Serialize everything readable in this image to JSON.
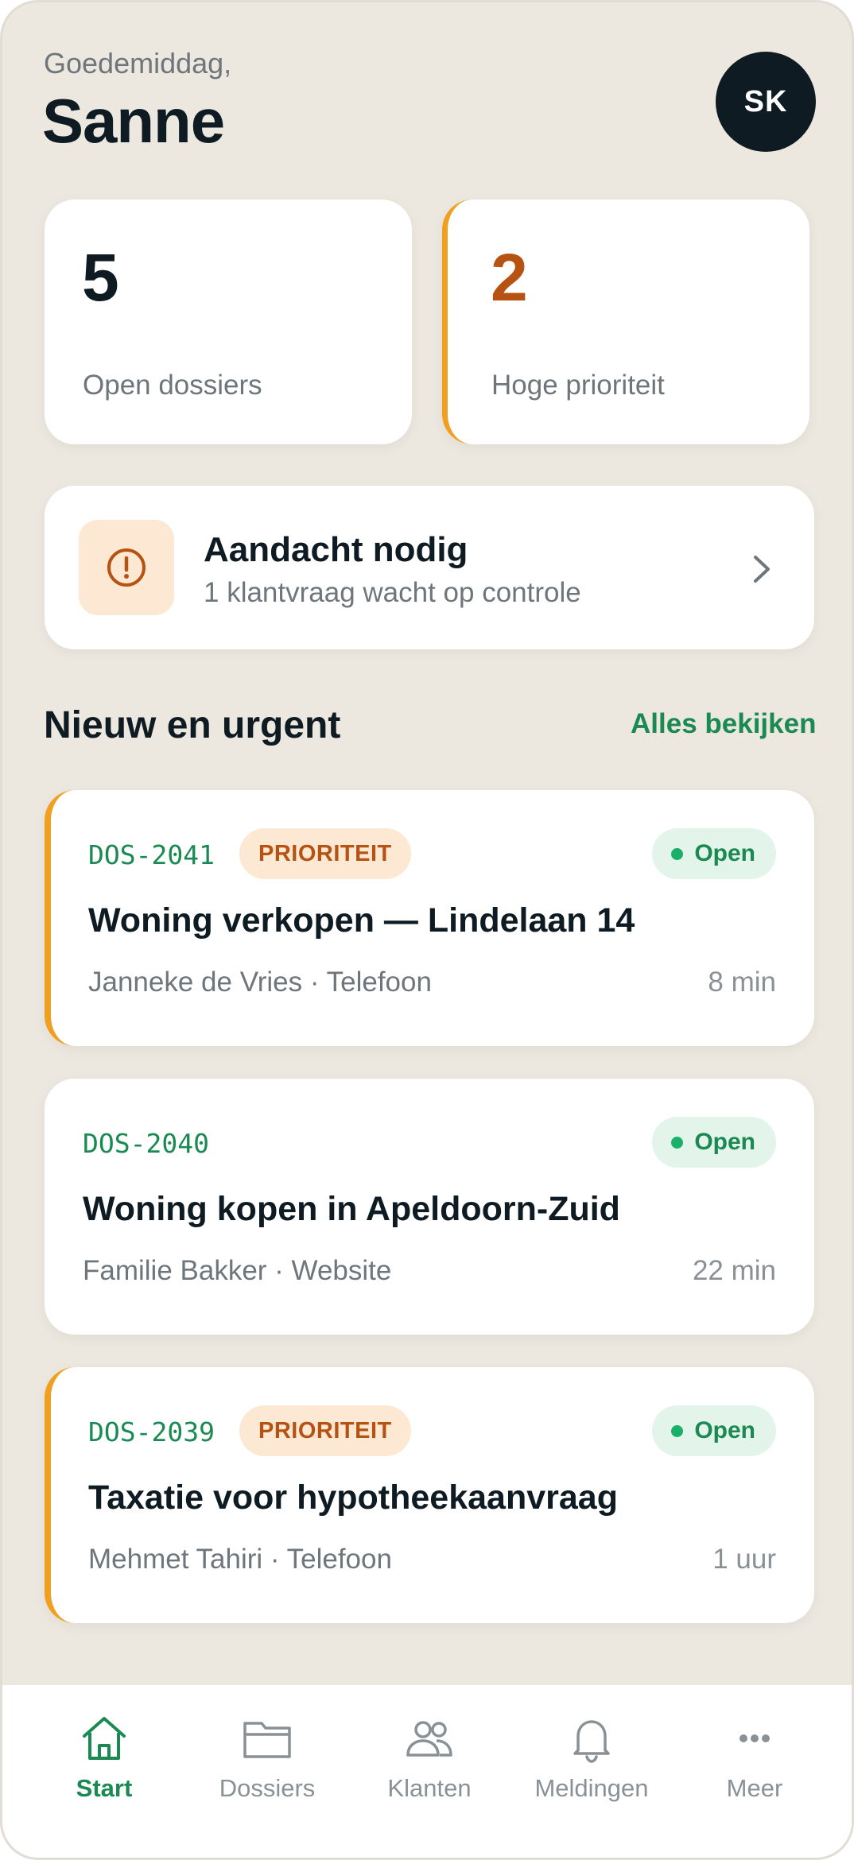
{
  "header": {
    "greeting": "Goedemiddag,",
    "name": "Sanne",
    "avatar_initials": "SK"
  },
  "stats": [
    {
      "value": "5",
      "label": "Open dossiers"
    },
    {
      "value": "2",
      "label": "Hoge prioriteit"
    }
  ],
  "attention": {
    "icon": "alert-circle-icon",
    "title": "Aandacht nodig",
    "subtitle": "1 klantvraag wacht op controle"
  },
  "section": {
    "title": "Nieuw en urgent",
    "see_all": "Alles bekijken"
  },
  "dossiers": [
    {
      "code": "DOS-2041",
      "badge": "PRIORITEIT",
      "status": "Open",
      "title": "Woning verkopen — Lindelaan 14",
      "meta": "Janneke de Vries · Telefoon",
      "time": "8 min"
    },
    {
      "code": "DOS-2040",
      "badge": "",
      "status": "Open",
      "title": "Woning kopen in Apeldoorn-Zuid",
      "meta": "Familie Bakker · Website",
      "time": "22 min"
    },
    {
      "code": "DOS-2039",
      "badge": "PRIORITEIT",
      "status": "Open",
      "title": "Taxatie voor hypotheekaanvraag",
      "meta": "Mehmet Tahiri · Telefoon",
      "time": "1 uur"
    }
  ],
  "nav": [
    {
      "label": "Start",
      "icon": "home-icon",
      "active": true
    },
    {
      "label": "Dossiers",
      "icon": "folder-icon",
      "active": false
    },
    {
      "label": "Klanten",
      "icon": "users-icon",
      "active": false
    },
    {
      "label": "Meldingen",
      "icon": "bell-icon",
      "active": false
    },
    {
      "label": "Meer",
      "icon": "more-icon",
      "active": false
    }
  ],
  "colors": {
    "background": "#ece7df",
    "accent_green": "#1a8a52",
    "priority_orange": "#f0a020",
    "priority_text": "#b65312",
    "dark": "#0f1b22"
  }
}
